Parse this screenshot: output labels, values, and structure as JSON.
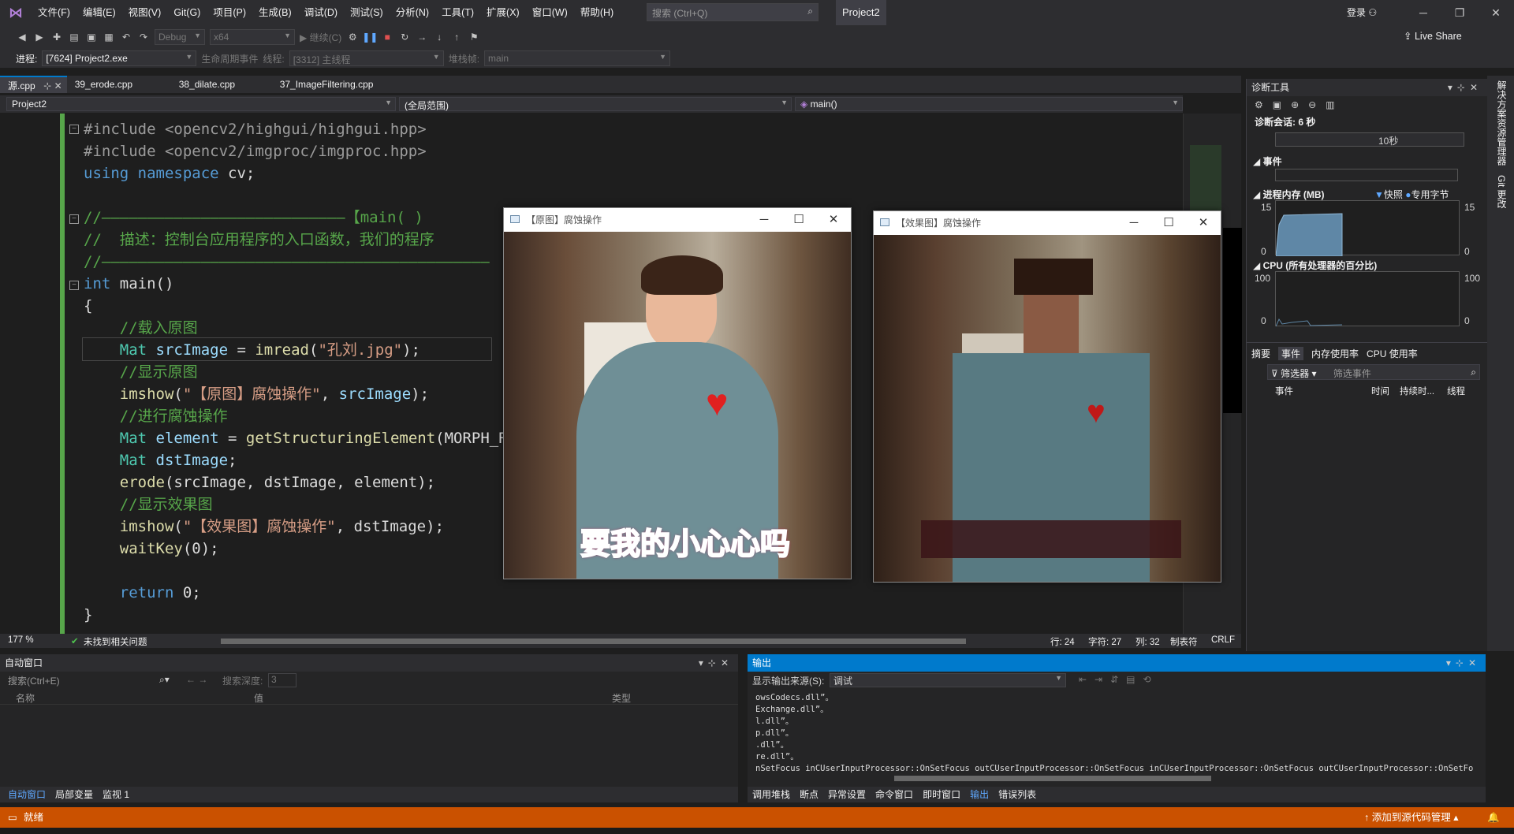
{
  "menubar": {
    "items": [
      "文件(F)",
      "编辑(E)",
      "视图(V)",
      "Git(G)",
      "项目(P)",
      "生成(B)",
      "调试(D)",
      "测试(S)",
      "分析(N)",
      "工具(T)",
      "扩展(X)",
      "窗口(W)",
      "帮助(H)"
    ],
    "search_placeholder": "搜索 (Ctrl+Q)",
    "project": "Project2",
    "login": "登录"
  },
  "toolbar": {
    "config": "Debug",
    "platform": "x64",
    "continue": "继续(C)",
    "live_share": "Live Share"
  },
  "toolbar2": {
    "process_label": "进程:",
    "process": "[7624] Project2.exe",
    "lifecycle": "生命周期事件",
    "thread_label": "线程:",
    "thread": "[3312] 主线程",
    "stack_label": "堆栈帧:",
    "stack": "main"
  },
  "tabs": [
    "源.cpp",
    "39_erode.cpp",
    "38_dilate.cpp",
    "37_ImageFiltering.cpp"
  ],
  "navbar": {
    "project": "Project2",
    "scope": "(全局范围)",
    "func": "main()"
  },
  "code": {
    "l1": "#include <opencv2/highgui/highgui.hpp>",
    "l2": "#include <opencv2/imgproc/imgproc.hpp>",
    "l3a": "using namespace",
    "l3b": " cv;",
    "l4": "//———————————————————————————【main( )",
    "l5": "//  描述：控制台应用程序的入口函数，我们的程序",
    "l6": "//———————————————————————————————————————————",
    "l7a": "int",
    "l7b": " main()",
    "l8": "{",
    "l9": "    //载入原图",
    "l10a": "    Mat",
    "l10b": " srcImage",
    "l10c": " = ",
    "l10d": "imread",
    "l10e": "(",
    "l10f": "\"孔刘.jpg\"",
    "l10g": ");",
    "l11": "    //显示原图",
    "l12a": "    imshow",
    "l12b": "(",
    "l12c": "\"【原图】腐蚀操作\"",
    "l12d": ", ",
    "l12e": "srcImage",
    "l12f": ");",
    "l13": "    //进行腐蚀操作",
    "l14a": "    Mat",
    "l14b": " element",
    "l14c": " = ",
    "l14d": "getStructuringElement",
    "l14e": "(MORPH_R",
    "l15a": "    Mat",
    "l15b": " dstImage",
    "l16a": "    erode",
    "l16b": "(srcImage, dstImage, element);",
    "l17": "    //显示效果图",
    "l18a": "    imshow",
    "l18b": "(",
    "l18c": "\"【效果图】腐蚀操作\"",
    "l18d": ", dstImage);",
    "l19a": "    waitKey",
    "l19b": "(0);",
    "l20a": "    return",
    "l20b": " 0;",
    "l21": "}"
  },
  "status_line": {
    "zoom": "177 %",
    "issues": "未找到相关问题",
    "row": "行: 24",
    "char": "字符: 27",
    "col": "列: 32",
    "tabs": "制表符",
    "eol": "CRLF"
  },
  "diag": {
    "title": "诊断工具",
    "session": "诊断会话: 6 秒",
    "timeline": "10秒",
    "events": "事件",
    "memory": "进程内存 (MB)",
    "snapshot": "快照",
    "private_bytes": "专用字节",
    "mem_max": "15",
    "mem_min": "0",
    "cpu": "CPU (所有处理器的百分比)",
    "cpu_max": "100",
    "cpu_min": "0",
    "tabs": [
      "摘要",
      "事件",
      "内存使用率",
      "CPU 使用率"
    ],
    "filter": "筛选器",
    "filter_placeholder": "筛选事件",
    "cols": [
      "事件",
      "时间",
      "持续时...",
      "线程"
    ]
  },
  "right_strip": [
    "解决方案资源管理器",
    "Git 更改"
  ],
  "autos": {
    "title": "自动窗口",
    "search_placeholder": "搜索(Ctrl+E)",
    "depth_label": "搜索深度:",
    "depth": "3",
    "cols": [
      "名称",
      "值",
      "类型"
    ]
  },
  "output": {
    "title": "输出",
    "source_label": "显示输出来源(S):",
    "source": "调试",
    "lines": [
      "owsCodecs.dll”。",
      "Exchange.dll”。",
      "l.dll”。",
      "p.dll”。",
      ".dll”。",
      "re.dll”。",
      "nSetFocus inCUserInputProcessor::OnSetFocus outCUserInputProcessor::OnSetFocus inCUserInputProcessor::OnSetFocus outCUserInputProcessor::OnSetFocus out"
    ]
  },
  "bottom_tabs_left": [
    "自动窗口",
    "局部变量",
    "监视 1"
  ],
  "bottom_tabs_right": [
    "调用堆栈",
    "断点",
    "异常设置",
    "命令窗口",
    "即时窗口",
    "输出",
    "错误列表"
  ],
  "statusbar": {
    "ready": "就绪",
    "source_control": "添加到源代码管理"
  },
  "win1": {
    "title": "【原图】腐蚀操作",
    "caption": "要我的小心心吗"
  },
  "win2": {
    "title": "【效果图】腐蚀操作"
  },
  "colors": {
    "accent": "#007acc",
    "status": "#ca5100",
    "heart": "#e02020"
  }
}
